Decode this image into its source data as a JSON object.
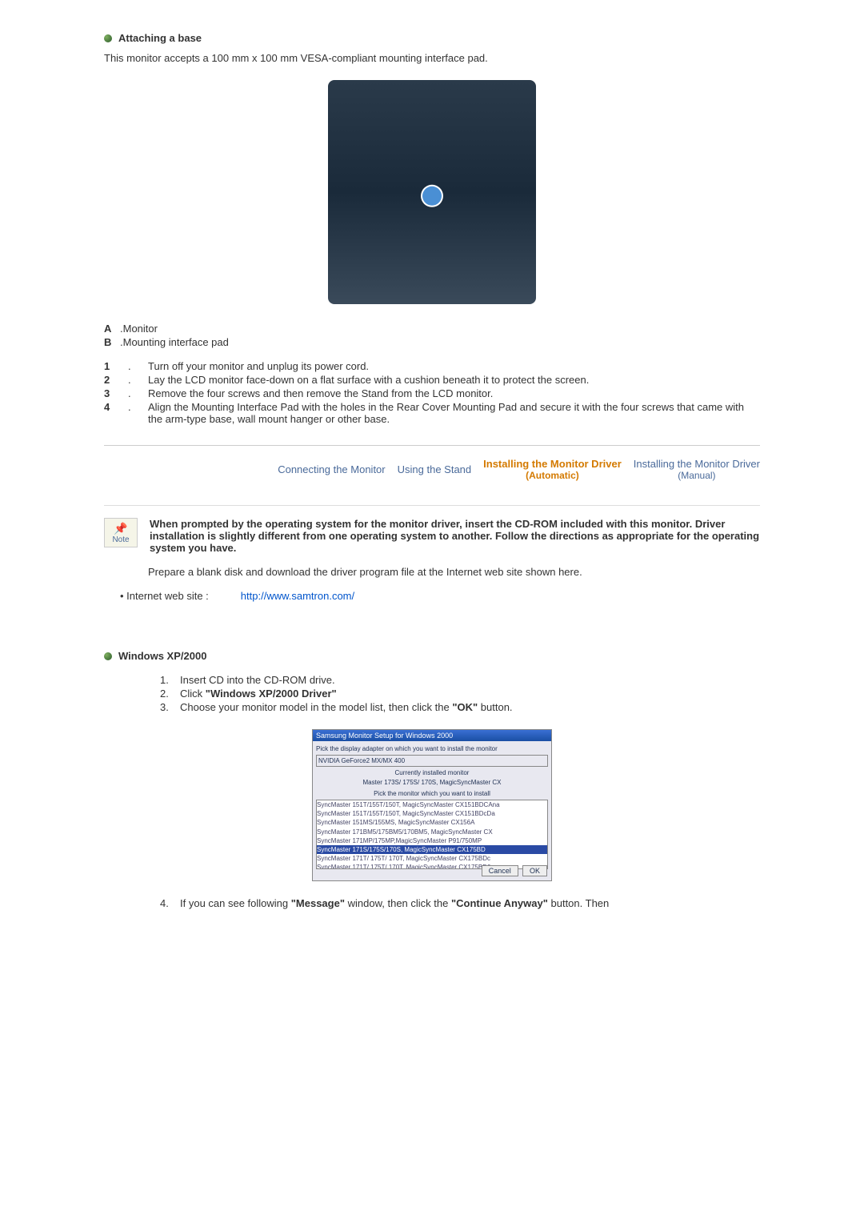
{
  "section1": {
    "title": "Attaching a base",
    "intro": "This monitor accepts a 100 mm x 100 mm VESA-compliant mounting interface pad.",
    "labels": {
      "a_key": "A",
      "a_text": ".Monitor",
      "b_key": "B",
      "b_text": ".Mounting interface pad"
    },
    "steps": [
      {
        "num": "1",
        "text": "Turn off your monitor and unplug its power cord."
      },
      {
        "num": "2",
        "text": "Lay the LCD monitor face-down on a flat surface with a cushion beneath it to protect the screen."
      },
      {
        "num": "3",
        "text": "Remove the four screws and then remove the Stand from the LCD monitor."
      },
      {
        "num": "4",
        "text": "Align the Mounting Interface Pad with the holes in the Rear Cover Mounting Pad and secure it with the four screws that came with the arm-type base, wall mount hanger or other base."
      }
    ]
  },
  "tabs": {
    "connecting": "Connecting the Monitor",
    "using": "Using the Stand",
    "install_auto": "Installing the Monitor Driver",
    "install_auto_sub": "(Automatic)",
    "install_manual": "Installing the Monitor Driver",
    "install_manual_sub": "(Manual)"
  },
  "note": {
    "label": "Note",
    "text": "When prompted by the operating system for the monitor driver, insert the CD-ROM included with this monitor. Driver installation is slightly different from one operating system to another. Follow the directions as appropriate for the operating system you have.",
    "prepare": "Prepare a blank disk and download the driver program file at the Internet web site shown here."
  },
  "link": {
    "label": "Internet web site :",
    "url": "http://www.samtron.com/"
  },
  "win": {
    "title": "Windows XP/2000",
    "steps": [
      {
        "num": "1.",
        "text": "Insert CD into the CD-ROM drive."
      },
      {
        "num": "2.",
        "prefix": "Click ",
        "bold": "\"Windows XP/2000 Driver\""
      },
      {
        "num": "3.",
        "prefix": "Choose your monitor model in the model list, then click the ",
        "bold": "\"OK\"",
        "suffix": " button."
      }
    ],
    "step4": {
      "num": "4.",
      "prefix": "If you can see following ",
      "bold1": "\"Message\"",
      "mid": " window, then click the ",
      "bold2": "\"Continue Anyway\"",
      "suffix": " button. Then"
    }
  },
  "dialog": {
    "title": "Samsung Monitor Setup for Windows 2000",
    "line1": "Pick the display adapter on which you want to install the monitor",
    "line2": "NVIDIA GeForce2 MX/MX 400",
    "line3": "Currently installed monitor",
    "line4": "Master 173S/ 175S/ 170S, MagicSyncMaster CX",
    "line5": "Pick the monitor which you want to install",
    "btn_cancel": "Cancel",
    "btn_ok": "OK"
  }
}
